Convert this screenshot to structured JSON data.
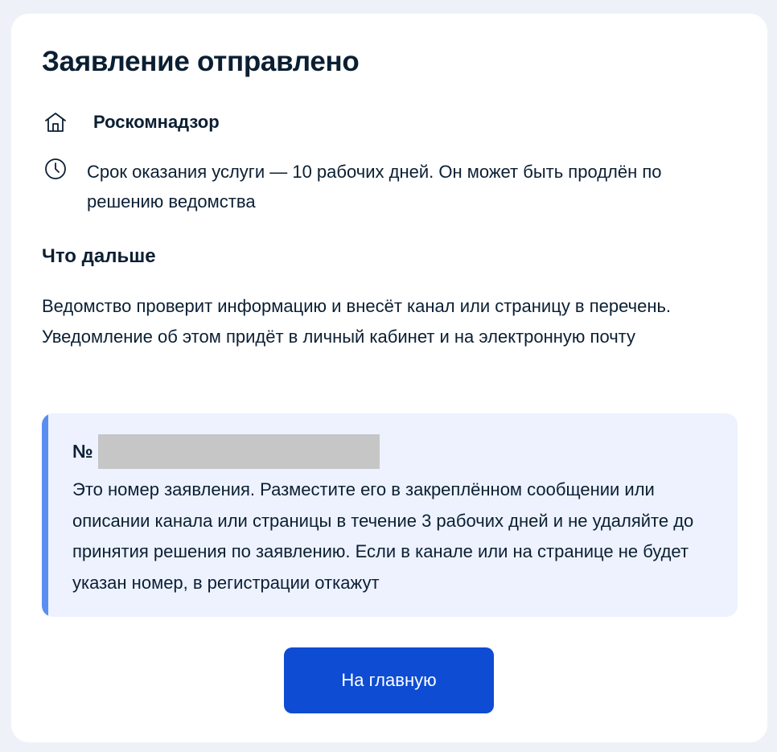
{
  "page": {
    "title": "Заявление отправлено"
  },
  "agency": {
    "icon": "building-icon",
    "name": "Роскомнадзор"
  },
  "term": {
    "icon": "clock-icon",
    "text": "Срок оказания услуги — 10 рабочих дней. Он может быть продлён по решению ведомства"
  },
  "next": {
    "title": "Что дальше",
    "text": "Ведомство проверит информацию и внесёт канал или страницу в перечень. Уведомление об этом придёт в личный кабинет и на электронную почту"
  },
  "notice": {
    "number_label": "№",
    "text": "Это номер заявления. Разместите его в закреплённом сообщении или описании канала или страницы в течение 3 рабочих дней и не удаляйте до принятия решения по заявлению. Если в канале или на странице не будет указан номер, в регистрации откажут",
    "accent_color": "#5a8ef1",
    "background_color": "#edf2fe"
  },
  "actions": {
    "home_label": "На главную",
    "button_color": "#0d4cd3"
  }
}
